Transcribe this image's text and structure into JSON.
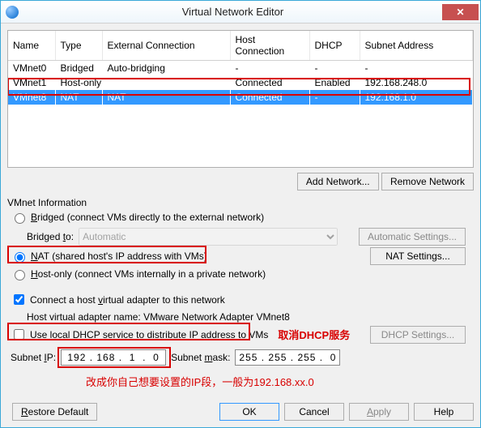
{
  "window": {
    "title": "Virtual Network Editor"
  },
  "grid": {
    "headers": [
      "Name",
      "Type",
      "External Connection",
      "Host Connection",
      "DHCP",
      "Subnet Address"
    ],
    "rows": [
      {
        "name": "VMnet0",
        "type": "Bridged",
        "ext": "Auto-bridging",
        "host": "-",
        "dhcp": "-",
        "subnet": "-",
        "selected": false
      },
      {
        "name": "VMnet1",
        "type": "Host-only",
        "ext": "",
        "host": "Connected",
        "dhcp": "Enabled",
        "subnet": "192.168.248.0",
        "selected": false
      },
      {
        "name": "VMnet8",
        "type": "NAT",
        "ext": "NAT",
        "host": "Connected",
        "dhcp": "-",
        "subnet": "192.168.1.0",
        "selected": true
      }
    ]
  },
  "buttons": {
    "add_network": "Add Network...",
    "remove_network": "Remove Network",
    "automatic_settings": "Automatic Settings...",
    "nat_settings": "NAT Settings...",
    "dhcp_settings": "DHCP Settings...",
    "restore_default": "Restore Default",
    "ok": "OK",
    "cancel": "Cancel",
    "apply": "Apply",
    "help": "Help"
  },
  "info": {
    "legend": "VMnet Information",
    "bridged_label": "Bridged (connect VMs directly to the external network)",
    "bridged_to": "Bridged to:",
    "bridged_to_value": "Automatic",
    "nat_label": "NAT (shared host's IP address with VMs)",
    "hostonly_label": "Host-only (connect VMs internally in a private network)",
    "connect_host_label": "Connect a host virtual adapter to this network",
    "host_adapter_prefix": "Host virtual adapter name: ",
    "host_adapter_name": "VMware Network Adapter VMnet8",
    "use_dhcp_label": "Use local DHCP service to distribute IP address to VMs",
    "subnet_ip_label": "Subnet IP:",
    "subnet_ip_value": "192 . 168 .  1  .  0",
    "subnet_mask_label": "Subnet mask:",
    "subnet_mask_value": "255 . 255 . 255 .  0"
  },
  "annotations": {
    "cancel_dhcp": "取消DHCP服务",
    "change_ip": "改成你自己想要设置的IP段，一般为192.168.xx.0"
  },
  "hotkeys": {
    "bridged_b": "B",
    "bridged_rest": "ridged (connect VMs directly to the external network)",
    "bridgedto_rest": "Bridged ",
    "bridgedto_t": "t",
    "bridgedto_tail": "o:",
    "nat_n": "N",
    "nat_rest": "AT (shared host's IP address with VMs)",
    "host_h": "H",
    "host_rest": "ost-only (connect VMs internally in a private network)",
    "connect_rest": "Connect a host ",
    "connect_v": "v",
    "connect_tail": "irtual adapter to this network",
    "dhcp_rest1": "Use local ",
    "dhcp_d": "D",
    "dhcp_rest2": "HCP service to distribute IP address to VMs",
    "subnetip_rest": "Subnet ",
    "subnetip_i": "I",
    "subnetip_tail": "P:",
    "subnetmask_rest": "Subnet ",
    "subnetmask_m": "m",
    "subnetmask_tail": "ask:"
  }
}
